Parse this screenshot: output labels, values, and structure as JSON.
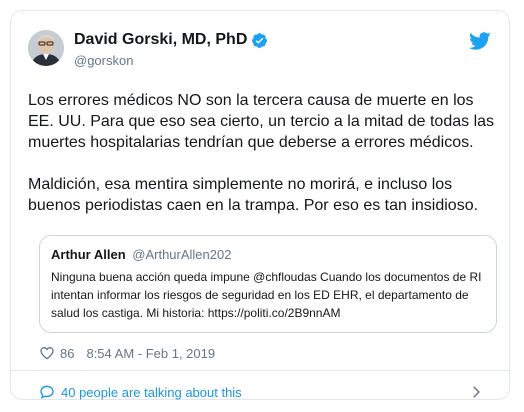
{
  "author": {
    "display_name": "David Gorski, MD, PhD",
    "handle": "@gorskon",
    "verified": true
  },
  "icons": {
    "avatar": "avatar",
    "verified": "verified-badge-icon",
    "brand": "twitter-bird-icon",
    "like": "heart-icon",
    "conversation": "speech-bubble-icon",
    "expand": "chevron-right-icon"
  },
  "tweet": {
    "paragraphs": [
      "Los errores médicos NO son la tercera causa de muerte en los EE. UU. Para que eso sea cierto, un tercio a la mitad de todas las muertes hospitalarias tendrían que deberse a errores médicos.",
      "Maldición, esa mentira simplemente no morirá, e incluso los buenos periodistas caen en la trampa. Por eso es tan insidioso."
    ]
  },
  "quoted_tweet": {
    "display_name": "Arthur Allen",
    "handle": "@ArthurAllen202",
    "text": "Ninguna buena acción queda impune @chfloudas Cuando los documentos de RI intentan informar los riesgos de seguridad en los ED EHR, el departamento de salud los castiga. Mi historia: https://politi.co/2B9nnAM"
  },
  "meta": {
    "likes": "86",
    "timestamp": "8:54 AM - Feb 1, 2019"
  },
  "footer": {
    "conversation_label": "40 people are talking about this"
  },
  "colors": {
    "brand_blue": "#1da1f2",
    "link_blue": "#1b95e0",
    "secondary_text": "#657786",
    "border": "#e1e8ed"
  }
}
